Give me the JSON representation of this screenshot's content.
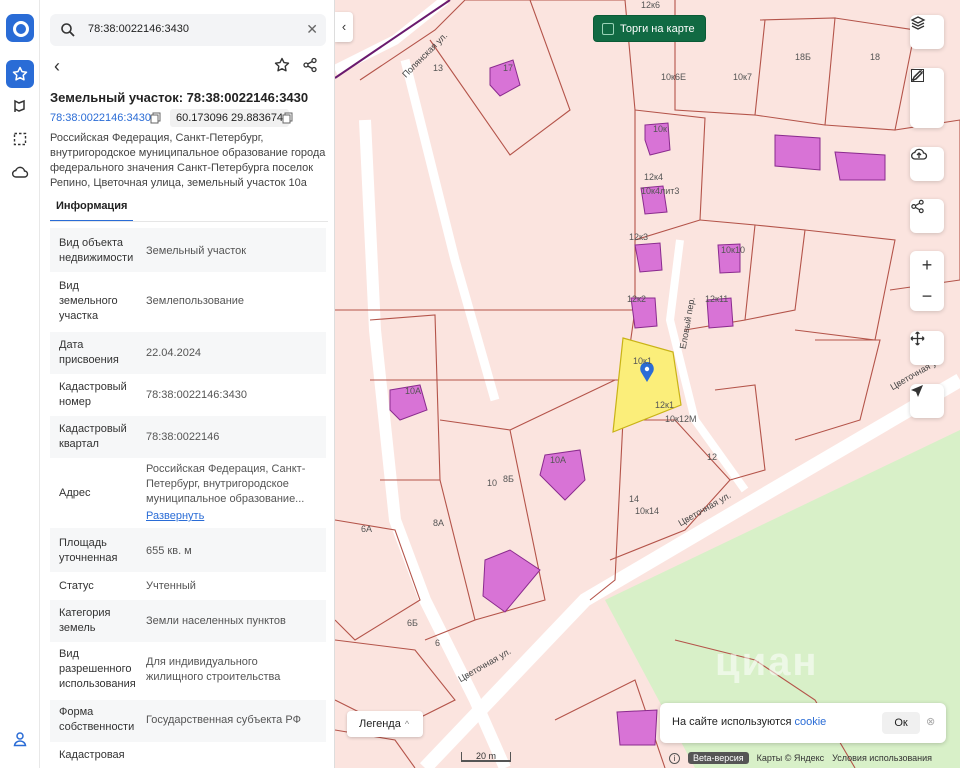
{
  "search": {
    "query": "78:38:0022146:3430"
  },
  "object": {
    "title": "Земельный участок: 78:38:0022146:3430",
    "cadastral_link": "78:38:0022146:3430",
    "coordinates": "60.173096 29.883674",
    "address_full": "Российская Федерация, Санкт-Петербург, внутригородское муниципальное образование города федерального значения Санкт-Петербурга поселок Репино, Цветочная улица, земельный участок 10а"
  },
  "tabs": {
    "info": "Информация"
  },
  "rows": [
    {
      "key": "Вид объекта недвижимости",
      "value": "Земельный участок"
    },
    {
      "key": "Вид земельного участка",
      "value": "Землепользование"
    },
    {
      "key": "Дата присвоения",
      "value": "22.04.2024"
    },
    {
      "key": "Кадастровый номер",
      "value": "78:38:0022146:3430"
    },
    {
      "key": "Кадастровый квартал",
      "value": "78:38:0022146"
    },
    {
      "key": "Адрес",
      "value": "Российская Федерация, Санкт-Петербург, внутригородское муниципальное образование...",
      "more": "Развернуть"
    },
    {
      "key": "Площадь уточненная",
      "value": "655 кв. м"
    },
    {
      "key": "Статус",
      "value": "Учтенный"
    },
    {
      "key": "Категория земель",
      "value": "Земли населенных пунктов"
    },
    {
      "key": "Вид разрешенного использования",
      "value": "Для индивидуального жилищного строительства"
    },
    {
      "key": "Форма собственности",
      "value": "Государственная субъекта РФ"
    },
    {
      "key": "Кадастровая",
      "value": ""
    }
  ],
  "map": {
    "torgi_label": "Торги на карте",
    "legend_label": "Легенда",
    "cookie_text": "На сайте используются ",
    "cookie_link": "cookie",
    "cookie_ok": "Ок",
    "scale_label": "20 m",
    "beta_label": "Beta-версия",
    "maps_credit": "Карты © Яндекс",
    "terms_label": "Условия использования",
    "watermark": "циан",
    "parcel_labels": [
      "13",
      "17",
      "10к6Е",
      "10к7",
      "18Б",
      "18",
      "12к6",
      "10к",
      "12к4",
      "10к4лит3",
      "12к3",
      "10к10",
      "12к2",
      "12к11",
      "10к1",
      "12к1",
      "10к12М",
      "10А",
      "10",
      "8Б",
      "10А",
      "12",
      "14",
      "10к14",
      "6А",
      "8А",
      "6Б",
      "6"
    ],
    "streets": [
      "Полянская ул.",
      "Еловый пер.",
      "Цветочная ул.",
      "Цветочная ул.",
      "Цветочная ул."
    ]
  },
  "colors": {
    "accent": "#2a6cd6",
    "building": "#d873d6",
    "selected": "#fbee7a",
    "forest": "#d8f0c8",
    "parcel": "#fbe4df"
  }
}
